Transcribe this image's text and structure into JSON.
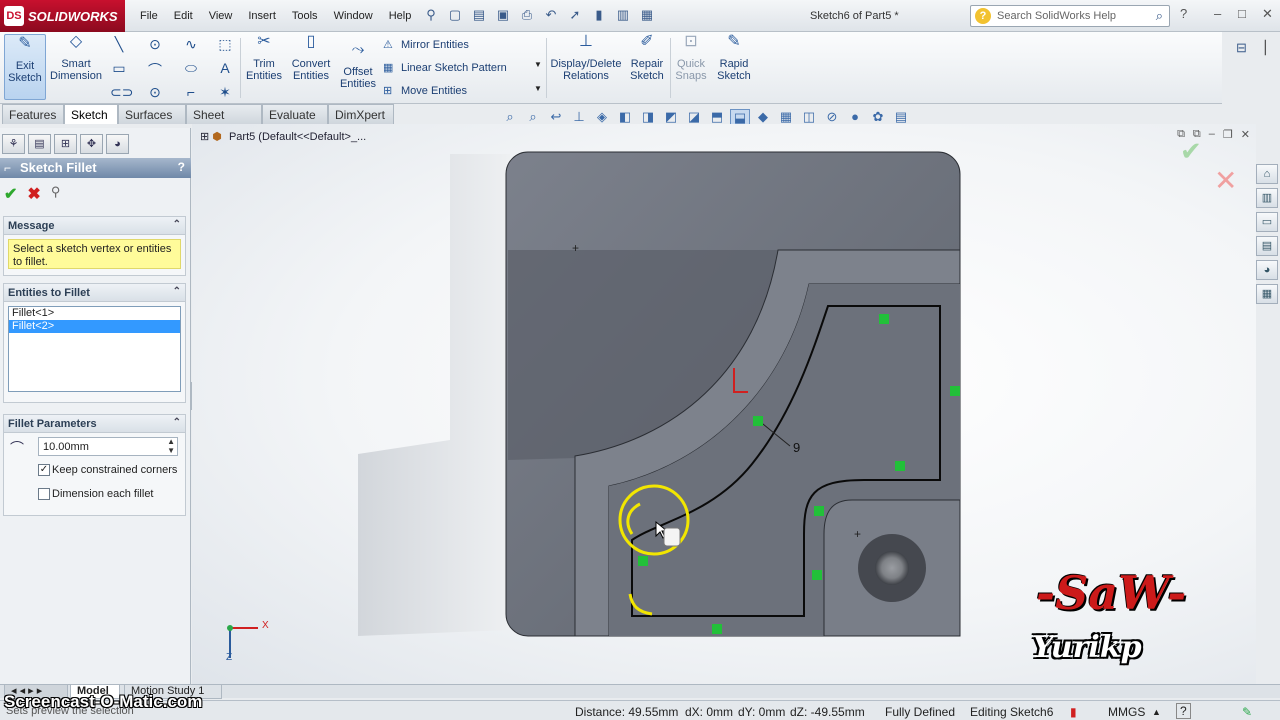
{
  "app": {
    "name": "SOLIDWORKS",
    "logo_mark": "DS",
    "doc_title": "Sketch6 of Part5 *",
    "search_placeholder": "Search SolidWorks Help"
  },
  "menus": [
    "File",
    "Edit",
    "View",
    "Insert",
    "Tools",
    "Window",
    "Help"
  ],
  "command_manager": {
    "exit_sketch": "Exit Sketch",
    "smart_dimension": "Smart Dimension",
    "trim_entities": "Trim Entities",
    "convert_entities": "Convert Entities",
    "offset_entities": "Offset Entities",
    "mirror_entities": "Mirror Entities",
    "linear_sketch_pattern": "Linear Sketch Pattern",
    "move_entities": "Move Entities",
    "display_delete_relations": "Display/Delete Relations",
    "repair_sketch": "Repair Sketch",
    "quick_snaps": "Quick Snaps",
    "rapid_sketch": "Rapid Sketch"
  },
  "tabs": [
    "Features",
    "Sketch",
    "Surfaces",
    "Sheet Metal",
    "Evaluate",
    "DimXpert"
  ],
  "active_tab": "Sketch",
  "feature_tree": {
    "crumb": "Part5  (Default<<Default>_..."
  },
  "property_manager": {
    "title": "Sketch Fillet",
    "help": "?",
    "message_header": "Message",
    "message_text": "Select a sketch vertex or entities to fillet.",
    "entities_header": "Entities to Fillet",
    "entities": [
      {
        "label": "Fillet<1>",
        "selected": false
      },
      {
        "label": "Fillet<2>",
        "selected": true
      }
    ],
    "params_header": "Fillet Parameters",
    "radius_value": "10.00mm",
    "keep_constrained_corners": {
      "label": "Keep constrained corners",
      "checked": true
    },
    "dimension_each_fillet": {
      "label": "Dimension each fillet",
      "checked": false
    }
  },
  "viewport": {
    "dimension_label": "9",
    "triad_x": "X",
    "triad_z": "Z"
  },
  "bottom_tabs": [
    "Model",
    "Motion Study 1"
  ],
  "active_bottom_tab": "Model",
  "status": {
    "distance": "Distance: 49.55mm",
    "dx": "dX: 0mm",
    "dy": "dY: 0mm",
    "dz": "dZ: -49.55mm",
    "defined": "Fully Defined",
    "editing": "Editing Sketch6",
    "units": "MMGS",
    "help": "?",
    "left_hint": "Sets preview the selection"
  },
  "watermarks": {
    "screencast": "Screencast-O-Matic.com",
    "saw": "-SaW-",
    "author": "Yurikp"
  },
  "colors": {
    "brand_red": "#c8102e",
    "part_gray": "#6b707a",
    "sketch_green": "#22c039",
    "fillet_yellow": "#f2e600"
  }
}
